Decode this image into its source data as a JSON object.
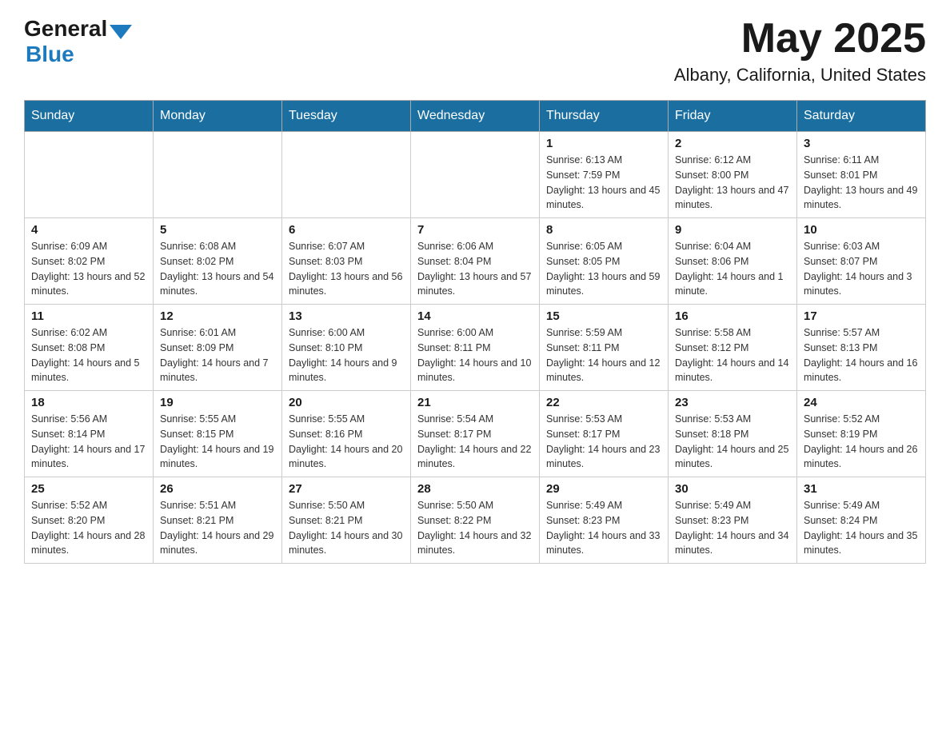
{
  "header": {
    "logo_general": "General",
    "logo_blue": "Blue",
    "title": "May 2025",
    "location": "Albany, California, United States"
  },
  "calendar": {
    "days_of_week": [
      "Sunday",
      "Monday",
      "Tuesday",
      "Wednesday",
      "Thursday",
      "Friday",
      "Saturday"
    ],
    "weeks": [
      [
        {
          "day": "",
          "info": ""
        },
        {
          "day": "",
          "info": ""
        },
        {
          "day": "",
          "info": ""
        },
        {
          "day": "",
          "info": ""
        },
        {
          "day": "1",
          "info": "Sunrise: 6:13 AM\nSunset: 7:59 PM\nDaylight: 13 hours and 45 minutes."
        },
        {
          "day": "2",
          "info": "Sunrise: 6:12 AM\nSunset: 8:00 PM\nDaylight: 13 hours and 47 minutes."
        },
        {
          "day": "3",
          "info": "Sunrise: 6:11 AM\nSunset: 8:01 PM\nDaylight: 13 hours and 49 minutes."
        }
      ],
      [
        {
          "day": "4",
          "info": "Sunrise: 6:09 AM\nSunset: 8:02 PM\nDaylight: 13 hours and 52 minutes."
        },
        {
          "day": "5",
          "info": "Sunrise: 6:08 AM\nSunset: 8:02 PM\nDaylight: 13 hours and 54 minutes."
        },
        {
          "day": "6",
          "info": "Sunrise: 6:07 AM\nSunset: 8:03 PM\nDaylight: 13 hours and 56 minutes."
        },
        {
          "day": "7",
          "info": "Sunrise: 6:06 AM\nSunset: 8:04 PM\nDaylight: 13 hours and 57 minutes."
        },
        {
          "day": "8",
          "info": "Sunrise: 6:05 AM\nSunset: 8:05 PM\nDaylight: 13 hours and 59 minutes."
        },
        {
          "day": "9",
          "info": "Sunrise: 6:04 AM\nSunset: 8:06 PM\nDaylight: 14 hours and 1 minute."
        },
        {
          "day": "10",
          "info": "Sunrise: 6:03 AM\nSunset: 8:07 PM\nDaylight: 14 hours and 3 minutes."
        }
      ],
      [
        {
          "day": "11",
          "info": "Sunrise: 6:02 AM\nSunset: 8:08 PM\nDaylight: 14 hours and 5 minutes."
        },
        {
          "day": "12",
          "info": "Sunrise: 6:01 AM\nSunset: 8:09 PM\nDaylight: 14 hours and 7 minutes."
        },
        {
          "day": "13",
          "info": "Sunrise: 6:00 AM\nSunset: 8:10 PM\nDaylight: 14 hours and 9 minutes."
        },
        {
          "day": "14",
          "info": "Sunrise: 6:00 AM\nSunset: 8:11 PM\nDaylight: 14 hours and 10 minutes."
        },
        {
          "day": "15",
          "info": "Sunrise: 5:59 AM\nSunset: 8:11 PM\nDaylight: 14 hours and 12 minutes."
        },
        {
          "day": "16",
          "info": "Sunrise: 5:58 AM\nSunset: 8:12 PM\nDaylight: 14 hours and 14 minutes."
        },
        {
          "day": "17",
          "info": "Sunrise: 5:57 AM\nSunset: 8:13 PM\nDaylight: 14 hours and 16 minutes."
        }
      ],
      [
        {
          "day": "18",
          "info": "Sunrise: 5:56 AM\nSunset: 8:14 PM\nDaylight: 14 hours and 17 minutes."
        },
        {
          "day": "19",
          "info": "Sunrise: 5:55 AM\nSunset: 8:15 PM\nDaylight: 14 hours and 19 minutes."
        },
        {
          "day": "20",
          "info": "Sunrise: 5:55 AM\nSunset: 8:16 PM\nDaylight: 14 hours and 20 minutes."
        },
        {
          "day": "21",
          "info": "Sunrise: 5:54 AM\nSunset: 8:17 PM\nDaylight: 14 hours and 22 minutes."
        },
        {
          "day": "22",
          "info": "Sunrise: 5:53 AM\nSunset: 8:17 PM\nDaylight: 14 hours and 23 minutes."
        },
        {
          "day": "23",
          "info": "Sunrise: 5:53 AM\nSunset: 8:18 PM\nDaylight: 14 hours and 25 minutes."
        },
        {
          "day": "24",
          "info": "Sunrise: 5:52 AM\nSunset: 8:19 PM\nDaylight: 14 hours and 26 minutes."
        }
      ],
      [
        {
          "day": "25",
          "info": "Sunrise: 5:52 AM\nSunset: 8:20 PM\nDaylight: 14 hours and 28 minutes."
        },
        {
          "day": "26",
          "info": "Sunrise: 5:51 AM\nSunset: 8:21 PM\nDaylight: 14 hours and 29 minutes."
        },
        {
          "day": "27",
          "info": "Sunrise: 5:50 AM\nSunset: 8:21 PM\nDaylight: 14 hours and 30 minutes."
        },
        {
          "day": "28",
          "info": "Sunrise: 5:50 AM\nSunset: 8:22 PM\nDaylight: 14 hours and 32 minutes."
        },
        {
          "day": "29",
          "info": "Sunrise: 5:49 AM\nSunset: 8:23 PM\nDaylight: 14 hours and 33 minutes."
        },
        {
          "day": "30",
          "info": "Sunrise: 5:49 AM\nSunset: 8:23 PM\nDaylight: 14 hours and 34 minutes."
        },
        {
          "day": "31",
          "info": "Sunrise: 5:49 AM\nSunset: 8:24 PM\nDaylight: 14 hours and 35 minutes."
        }
      ]
    ]
  }
}
